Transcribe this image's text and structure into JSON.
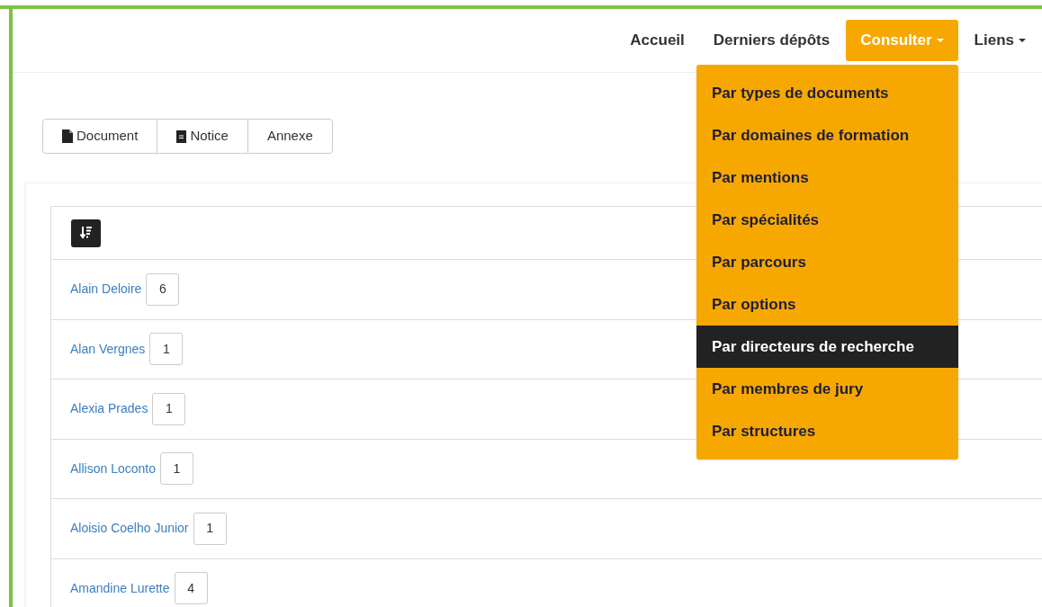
{
  "navbar": {
    "items": [
      {
        "label": "Accueil",
        "kind": "link",
        "selected": false
      },
      {
        "label": "Derniers dépôts",
        "kind": "link",
        "selected": false
      },
      {
        "label": "Consulter",
        "kind": "dropdown",
        "selected": true
      },
      {
        "label": "Liens",
        "kind": "dropdown",
        "selected": false
      }
    ]
  },
  "consult_menu": {
    "items": [
      {
        "label": "Par types de documents",
        "selected": false
      },
      {
        "label": "Par domaines de formation",
        "selected": false
      },
      {
        "label": "Par mentions",
        "selected": false
      },
      {
        "label": "Par spécialités",
        "selected": false
      },
      {
        "label": "Par parcours",
        "selected": false
      },
      {
        "label": "Par options",
        "selected": false
      },
      {
        "label": "Par directeurs de recherche",
        "selected": true
      },
      {
        "label": "Par membres de jury",
        "selected": false
      },
      {
        "label": "Par structures",
        "selected": false
      }
    ]
  },
  "filter_buttons": [
    {
      "label": "Document",
      "kind": "file"
    },
    {
      "label": "Notice",
      "kind": "note"
    },
    {
      "label": "Annexe",
      "kind": "plain"
    }
  ],
  "list": {
    "rows": [
      {
        "name": "Alain Deloire",
        "count": "6"
      },
      {
        "name": "Alan Vergnes",
        "count": "1"
      },
      {
        "name": "Alexia Prades",
        "count": "1"
      },
      {
        "name": "Allison Loconto",
        "count": "1"
      },
      {
        "name": "Aloisio Coelho Junior",
        "count": "1"
      },
      {
        "name": "Amandine Lurette",
        "count": "4"
      }
    ]
  }
}
